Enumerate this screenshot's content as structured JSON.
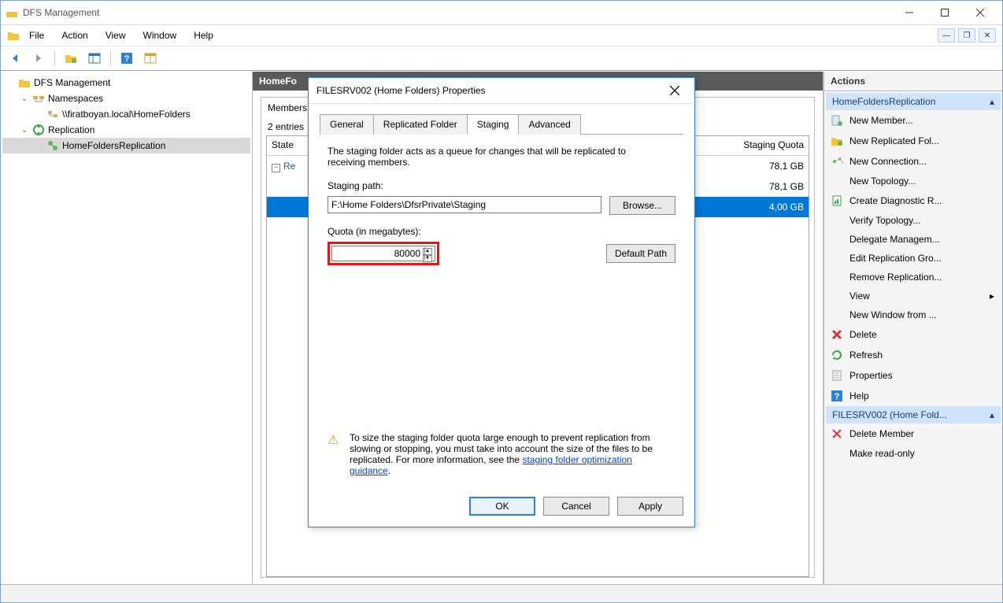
{
  "window": {
    "title": "DFS Management"
  },
  "menu": {
    "file": "File",
    "action": "Action",
    "view": "View",
    "window": "Window",
    "help": "Help"
  },
  "tree": {
    "root": "DFS Management",
    "namespaces": "Namespaces",
    "ns_item": "\\\\firatboyan.local\\HomeFolders",
    "replication": "Replication",
    "rep_item": "HomeFoldersReplication"
  },
  "center": {
    "title": "HomeFo",
    "tab0": "Members",
    "entries": "2 entries",
    "col_state": "State",
    "col_quota": "Staging Quota",
    "row0_state": "Re",
    "row0_quota": "78,1 GB",
    "row1_quota": "4,00 GB"
  },
  "dialog": {
    "title": "FILESRV002 (Home Folders) Properties",
    "tabs": {
      "general": "General",
      "replicated": "Replicated Folder",
      "staging": "Staging",
      "advanced": "Advanced"
    },
    "desc": "The staging folder acts as a queue for changes that will be replicated to receiving members.",
    "staging_path_label": "Staging path:",
    "staging_path": "F:\\Home Folders\\DfsrPrivate\\Staging",
    "browse": "Browse...",
    "quota_label": "Quota (in megabytes):",
    "quota_value": "80000",
    "default_path": "Default Path",
    "warn": "To size the staging folder quota large enough to prevent replication from slowing or stopping, you must take into account the size of the files to be replicated. For more information, see the ",
    "warn_link": "staging folder optimization guidance",
    "warn_after": ".",
    "ok": "OK",
    "cancel": "Cancel",
    "apply": "Apply"
  },
  "actions": {
    "header": "Actions",
    "sec1": "HomeFoldersReplication",
    "items1": [
      "New Member...",
      "New Replicated Fol...",
      "New Connection...",
      "New Topology...",
      "Create Diagnostic R...",
      "Verify Topology...",
      "Delegate Managem...",
      "Edit Replication Gro...",
      "Remove Replication...",
      "View",
      "New Window from ...",
      "Delete",
      "Refresh",
      "Properties",
      "Help"
    ],
    "sec2": "FILESRV002 (Home Fold...",
    "items2": [
      "Delete Member",
      "Make read-only"
    ]
  }
}
